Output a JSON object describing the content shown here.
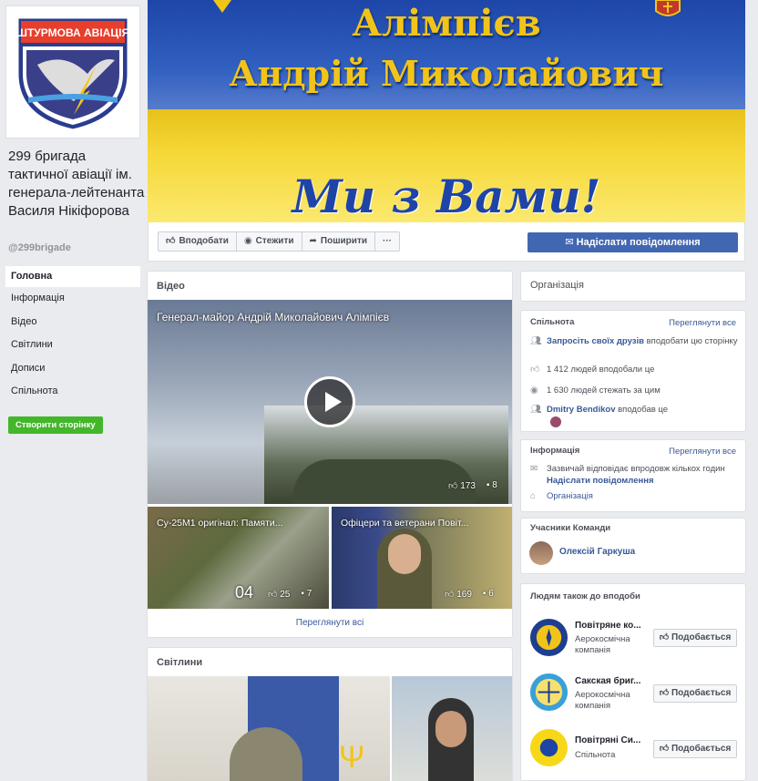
{
  "page": {
    "name": "299 бригада тактичної авіації ім. генерала-лейтенанта Василя Нікіфорова",
    "handle": "@299brigade",
    "badge_text": "ШТУРМОВА АВІАЦІЯ"
  },
  "nav": {
    "items": [
      "Головна",
      "Інформація",
      "Відео",
      "Світлини",
      "Дописи",
      "Спільнота"
    ],
    "create_page": "Створити сторінку"
  },
  "cover": {
    "line1": "Алімпієв",
    "line2": "Андрій Миколайович",
    "slogan": "Ми з Вами!"
  },
  "actions": {
    "like": "Вподобати",
    "follow": "Стежити",
    "share": "Поширити",
    "more": "···",
    "message": "Надіслати повідомлення"
  },
  "videos": {
    "title": "Відео",
    "main": {
      "title": "Генерал-майор Андрій Миколайович Алімпієв",
      "likes": "173",
      "comments": "8"
    },
    "thumbs": [
      {
        "title": "Су-25М1 оригінал: Памяти...",
        "duration": "04",
        "likes": "25",
        "comments": "7"
      },
      {
        "title": "Офіцери та ветерани Повіт...",
        "likes": "169",
        "comments": "6"
      }
    ],
    "see_all": "Переглянути всі"
  },
  "photos": {
    "title": "Світлини"
  },
  "right": {
    "organization": "Організація",
    "community": {
      "title": "Спільнота",
      "see_all": "Переглянути все",
      "invite_link": "Запросіть своїх друзів",
      "invite_rest": " вподобати цю сторінку",
      "likes": "1 412 людей вподобали це",
      "follows": "1 630 людей стежать за цим",
      "friend_name": "Dmitry Bendikov",
      "friend_rest": " вподобав це"
    },
    "info": {
      "title": "Інформація",
      "see_all": "Переглянути все",
      "response": "Зазвичай відповідає впродовж кількох годин",
      "send": "Надіслати повідомлення",
      "category": "Організація"
    },
    "team": {
      "title": "Учасники Команди",
      "member": "Олексій Гаркуша"
    },
    "also_like": {
      "title": "Людям також до вподоби",
      "like_label": "Подобається",
      "pages": [
        {
          "name": "Повітряне ко...",
          "category": "Аерокосмічна компанія"
        },
        {
          "name": "Сакская бриг...",
          "category": "Аерокосмічна компанія"
        },
        {
          "name": "Повітряні Си...",
          "category": "Спільнота"
        }
      ]
    }
  }
}
